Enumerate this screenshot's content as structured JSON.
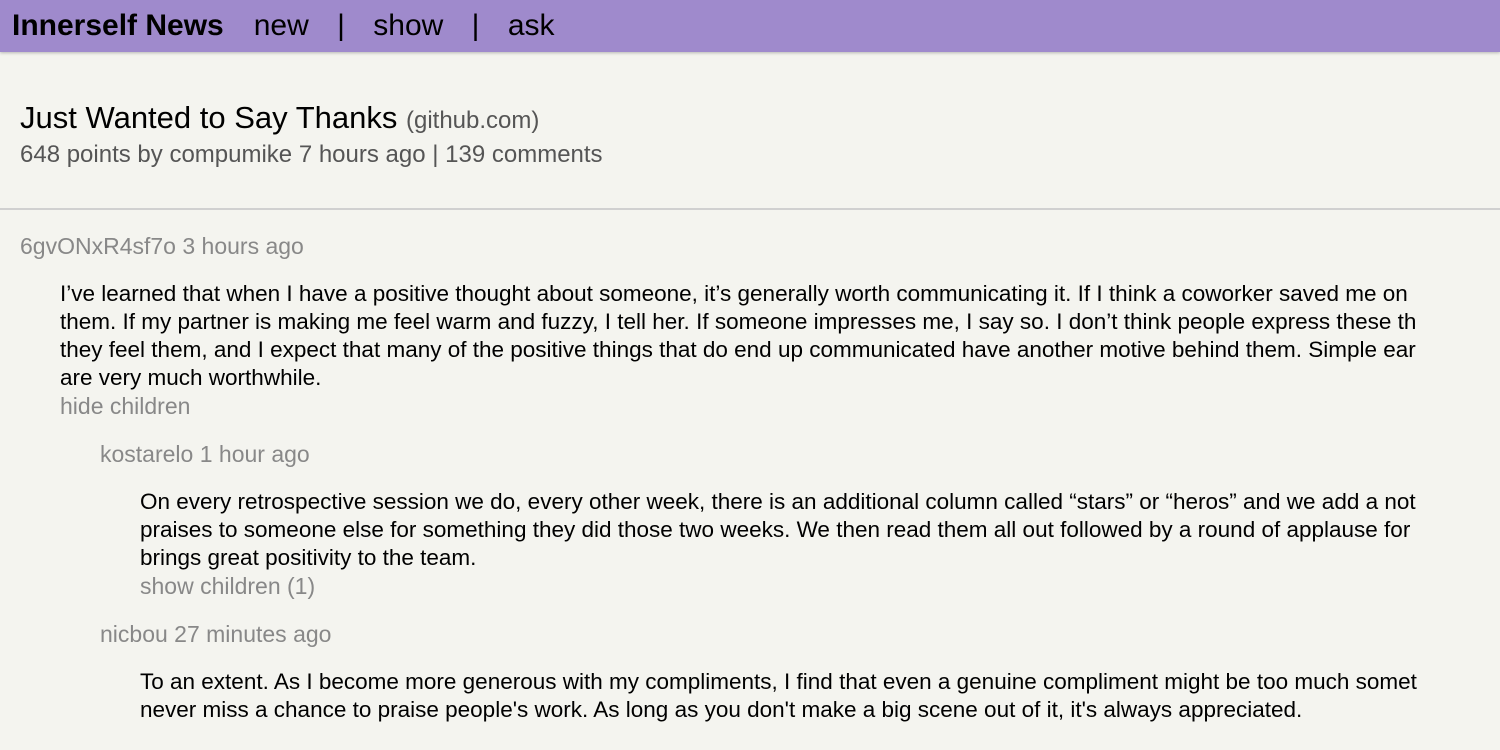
{
  "header": {
    "brand": "Innerself News",
    "nav": [
      "new",
      "show",
      "ask"
    ],
    "separator": "|",
    "background": "#9f8acc"
  },
  "story": {
    "title": "Just Wanted to Say Thanks",
    "site": "(github.com)",
    "meta": "648 points by compumike 7 hours ago | 139 comments"
  },
  "comments": [
    {
      "author_line": "6gvONxR4sf7o 3 hours ago",
      "lines": [
        "I’ve learned that when I have a positive thought about someone, it’s generally worth communicating it. If I think a coworker saved me on",
        "them. If my partner is making me feel warm and fuzzy, I tell her. If someone impresses me, I say so. I don’t think people express these th",
        "they feel them, and I expect that many of the positive things that do end up communicated have another motive behind them. Simple ear",
        "are very much worthwhile."
      ],
      "toggle": "hide children"
    },
    {
      "author_line": "kostarelo 1 hour ago",
      "lines": [
        "On every retrospective session we do, every other week, there is an additional column called “stars” or “heros” and we add a not",
        "praises to someone else for something they did those two weeks. We then read them all out followed by a round of applause for",
        "brings great positivity to the team."
      ],
      "toggle": "show children (1)"
    },
    {
      "author_line": "nicbou 27 minutes ago",
      "lines": [
        "To an extent. As I become more generous with my compliments, I find that even a genuine compliment might be too much somet",
        "never miss a chance to praise people's work. As long as you don't make a big scene out of it, it's always appreciated."
      ]
    }
  ]
}
